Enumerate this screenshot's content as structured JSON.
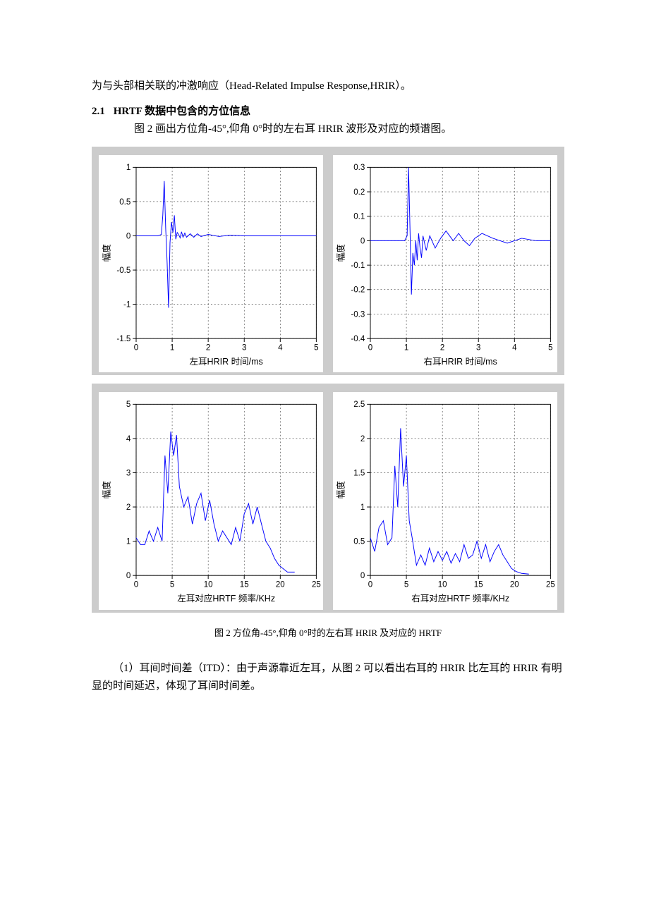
{
  "text": {
    "intro_tail": "为与头部相关联的冲激响应（Head-Related Impulse Response,HRIR）。",
    "sec21_num": "2.1",
    "sec21_title": "HRTF 数据中包含的方位信息",
    "sec21_p": "图 2 画出方位角-45°,仰角 0°时的左右耳 HRIR 波形及对应的频谱图。",
    "caption": "图 2 方位角-45°,仰角 0°时的左右耳 HRIR 及对应的 HRTF",
    "itd_p": "（1）耳间时间差（ITD）：由于声源靠近左耳，从图 2 可以看出右耳的 HRIR 比左耳的 HRIR 有明显的时间延迟，体现了耳间时间差。"
  },
  "chart_data": [
    {
      "type": "line",
      "title": "",
      "xlabel": "左耳HRIR  时间/ms",
      "ylabel": "幅度",
      "xlim": [
        0,
        5
      ],
      "ylim": [
        -1.5,
        1
      ],
      "xticks": [
        0,
        1,
        2,
        3,
        4,
        5
      ],
      "yticks": [
        -1.5,
        -1,
        -0.5,
        0,
        0.5,
        1
      ],
      "series": [
        {
          "name": "left HRIR",
          "x": [
            0.0,
            0.6,
            0.7,
            0.74,
            0.78,
            0.82,
            0.86,
            0.9,
            0.94,
            0.98,
            1.02,
            1.06,
            1.1,
            1.14,
            1.18,
            1.22,
            1.26,
            1.3,
            1.35,
            1.4,
            1.5,
            1.6,
            1.7,
            1.8,
            2.0,
            2.3,
            2.6,
            3.0,
            3.5,
            4.0,
            4.5,
            5.0
          ],
          "y": [
            0.0,
            0.0,
            0.02,
            0.3,
            0.8,
            0.1,
            -0.4,
            -1.05,
            -0.1,
            0.2,
            0.05,
            0.3,
            -0.05,
            0.05,
            0.02,
            -0.03,
            0.06,
            -0.02,
            0.04,
            -0.02,
            0.03,
            -0.02,
            0.03,
            -0.01,
            0.02,
            -0.01,
            0.01,
            0.0,
            0.0,
            0.0,
            0.0,
            0.0
          ]
        }
      ]
    },
    {
      "type": "line",
      "title": "",
      "xlabel": "右耳HRIR  时间/ms",
      "ylabel": "幅度",
      "xlim": [
        0,
        5
      ],
      "ylim": [
        -0.4,
        0.3
      ],
      "xticks": [
        0,
        1,
        2,
        3,
        4,
        5
      ],
      "yticks": [
        -0.4,
        -0.3,
        -0.2,
        -0.1,
        0,
        0.1,
        0.2,
        0.3
      ],
      "series": [
        {
          "name": "right HRIR",
          "x": [
            0.0,
            0.95,
            1.02,
            1.06,
            1.1,
            1.14,
            1.18,
            1.22,
            1.26,
            1.3,
            1.34,
            1.38,
            1.42,
            1.46,
            1.55,
            1.65,
            1.8,
            1.95,
            2.1,
            2.3,
            2.45,
            2.6,
            2.75,
            2.9,
            3.1,
            3.4,
            3.8,
            4.2,
            4.6,
            5.0
          ],
          "y": [
            0.0,
            0.0,
            0.02,
            0.3,
            0.05,
            -0.22,
            -0.05,
            -0.1,
            0.0,
            -0.08,
            0.03,
            -0.03,
            -0.07,
            0.02,
            -0.04,
            0.02,
            -0.03,
            0.01,
            0.04,
            0.0,
            0.03,
            0.0,
            -0.02,
            0.01,
            0.03,
            0.01,
            -0.01,
            0.01,
            0.0,
            0.0
          ]
        }
      ]
    },
    {
      "type": "line",
      "title": "",
      "xlabel": "左耳对应HRTF 频率/KHz",
      "ylabel": "幅度",
      "xlim": [
        0,
        25
      ],
      "ylim": [
        0,
        5
      ],
      "xticks": [
        0,
        5,
        10,
        15,
        20,
        25
      ],
      "yticks": [
        0,
        1,
        2,
        3,
        4,
        5
      ],
      "series": [
        {
          "name": "left HRTF",
          "x": [
            0.0,
            0.6,
            1.2,
            1.8,
            2.4,
            3.0,
            3.6,
            4.0,
            4.4,
            4.8,
            5.2,
            5.6,
            6.0,
            6.6,
            7.2,
            7.8,
            8.4,
            9.0,
            9.6,
            10.2,
            10.8,
            11.4,
            12.0,
            12.6,
            13.2,
            13.8,
            14.4,
            15.0,
            15.6,
            16.2,
            16.8,
            17.4,
            18.0,
            18.6,
            19.2,
            19.8,
            20.4,
            21.0,
            22.0
          ],
          "y": [
            1.1,
            0.9,
            0.9,
            1.3,
            1.0,
            1.4,
            1.0,
            3.5,
            2.4,
            4.2,
            3.5,
            4.1,
            2.6,
            2.0,
            2.3,
            1.5,
            2.1,
            2.4,
            1.6,
            2.2,
            1.5,
            1.0,
            1.3,
            1.1,
            0.9,
            1.4,
            1.0,
            1.8,
            2.1,
            1.5,
            2.0,
            1.5,
            1.0,
            0.8,
            0.5,
            0.3,
            0.2,
            0.1,
            0.1
          ]
        }
      ]
    },
    {
      "type": "line",
      "title": "",
      "xlabel": "右耳对应HRTF 频率/KHz",
      "ylabel": "幅度",
      "xlim": [
        0,
        25
      ],
      "ylim": [
        0,
        2.5
      ],
      "xticks": [
        0,
        5,
        10,
        15,
        20,
        25
      ],
      "yticks": [
        0,
        0.5,
        1,
        1.5,
        2,
        2.5
      ],
      "series": [
        {
          "name": "right HRTF",
          "x": [
            0.0,
            0.6,
            1.2,
            1.8,
            2.4,
            3.0,
            3.4,
            3.8,
            4.2,
            4.6,
            5.0,
            5.4,
            5.8,
            6.4,
            7.0,
            7.6,
            8.2,
            8.8,
            9.4,
            10.0,
            10.6,
            11.2,
            11.8,
            12.4,
            13.0,
            13.6,
            14.2,
            14.8,
            15.4,
            16.0,
            16.6,
            17.2,
            17.8,
            18.4,
            19.0,
            19.6,
            20.2,
            21.0,
            22.0
          ],
          "y": [
            0.55,
            0.35,
            0.7,
            0.8,
            0.45,
            0.55,
            1.6,
            1.0,
            2.15,
            1.3,
            1.75,
            0.8,
            0.55,
            0.15,
            0.3,
            0.15,
            0.4,
            0.2,
            0.35,
            0.22,
            0.35,
            0.18,
            0.32,
            0.2,
            0.45,
            0.25,
            0.3,
            0.5,
            0.25,
            0.45,
            0.2,
            0.35,
            0.45,
            0.3,
            0.2,
            0.1,
            0.06,
            0.03,
            0.02
          ]
        }
      ]
    }
  ]
}
